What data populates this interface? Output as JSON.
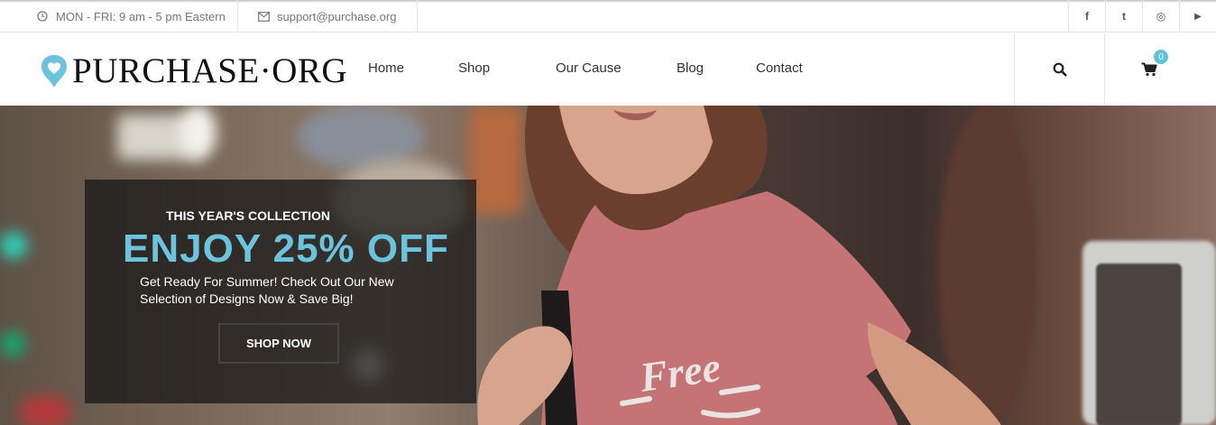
{
  "topbar": {
    "hours": "MON - FRI: 9 am - 5 pm Eastern",
    "email": "support@purchase.org",
    "social": [
      {
        "name": "facebook-icon",
        "glyph": "f"
      },
      {
        "name": "twitter-icon",
        "glyph": "t"
      },
      {
        "name": "instagram-icon",
        "glyph": "◎"
      },
      {
        "name": "youtube-icon",
        "glyph": "▶"
      }
    ]
  },
  "header": {
    "logo_text": "PURCHASE·ORG",
    "nav": [
      "Home",
      "Shop",
      "Our Cause",
      "Blog",
      "Contact"
    ],
    "cart_count": "0"
  },
  "hero": {
    "kicker": "THIS YEAR'S COLLECTION",
    "headline": "ENJOY 25% OFF",
    "subtext": "Get Ready For Summer! Check Out Our New Selection of Designs Now & Save Big!",
    "button": "SHOP NOW",
    "shirt_text": "Free"
  },
  "colors": {
    "accent": "#6cc3de",
    "badge": "#5ec3d8"
  }
}
